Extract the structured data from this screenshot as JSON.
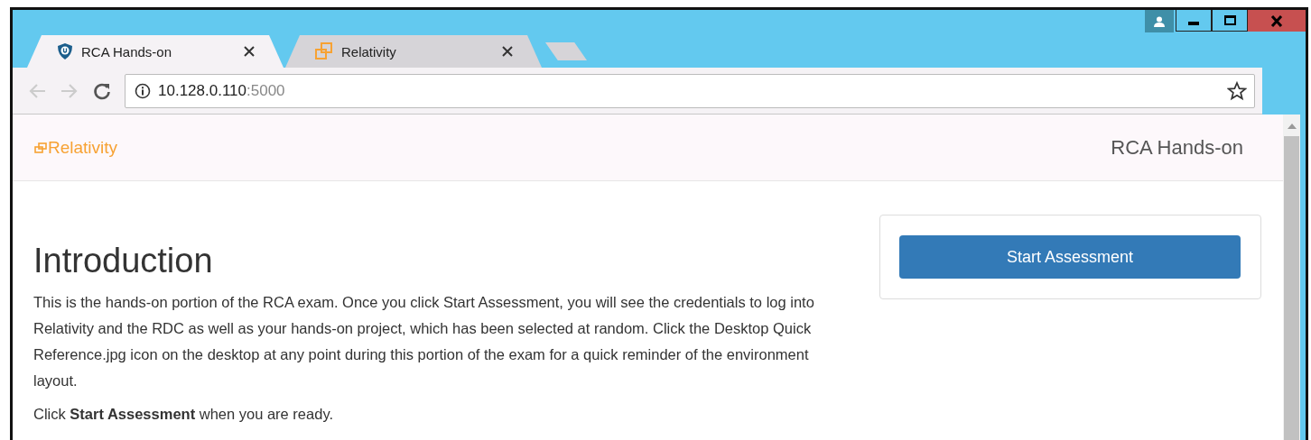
{
  "tabs": [
    {
      "title": "RCA Hands-on",
      "selected": true
    },
    {
      "title": "Relativity",
      "selected": false
    }
  ],
  "address_bar": {
    "host": "10.128.0.110",
    "port": ":5000"
  },
  "page": {
    "brand": "Relativity",
    "site_title": "RCA Hands-on",
    "heading": "Introduction",
    "paragraphs": [
      "This is the hands-on portion of the RCA exam. Once you click Start Assessment, you will see the credentials to log into Relativity and the RDC as well as your hands-on project, which has been selected at random. Click the Desktop Quick Reference.jpg icon on the desktop at any point during this portion of the exam for a quick reminder of the environment layout.",
      "Click **Start Assessment** when you are ready."
    ],
    "button": "Start Assessment"
  }
}
